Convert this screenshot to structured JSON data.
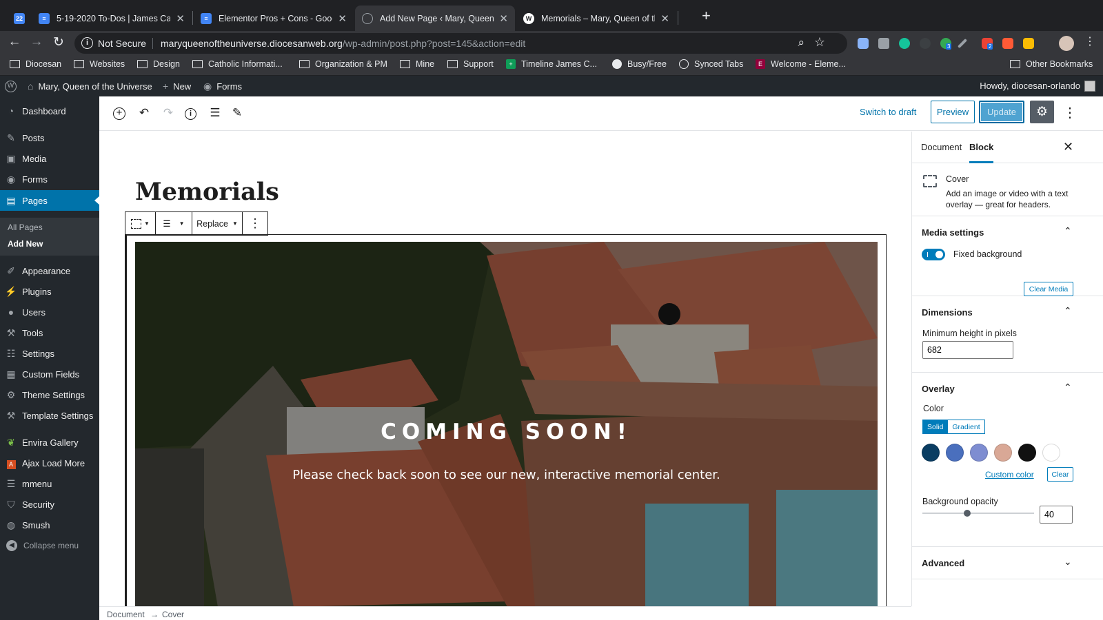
{
  "browser": {
    "tabs": [
      {
        "title": "22",
        "icon": "calendar-icon",
        "color": "#4285f4"
      },
      {
        "title": "5-19-2020 To-Dos | James Ca",
        "icon": "docs-icon",
        "color": "#4285f4"
      },
      {
        "title": "Elementor Pros + Cons - Goog",
        "icon": "docs-icon",
        "color": "#4285f4"
      },
      {
        "title": "Add New Page ‹ Mary, Queen c",
        "icon": "globe-icon",
        "color": "#5f6368"
      },
      {
        "title": "Memorials – Mary, Queen of th",
        "icon": "wordpress-icon",
        "color": "#ffffff"
      }
    ],
    "url": {
      "security": "Not Secure",
      "domain": "maryqueenoftheuniverse.diocesanweb.org",
      "path": "/wp-admin/post.php?post=145&action=edit"
    },
    "bookmarks": [
      "Diocesan",
      "Websites",
      "Design",
      "Catholic Informati...",
      "Organization & PM",
      "Mine",
      "Support",
      "Timeline James C...",
      "Busy/Free",
      "Synced Tabs",
      "Welcome - Eleme...",
      "Other Bookmarks"
    ],
    "extension_badges": [
      "3",
      "2"
    ]
  },
  "adminbar": {
    "site": "Mary, Queen of the Universe",
    "new": "New",
    "forms": "Forms",
    "howdy": "Howdy, diocesan-orlando"
  },
  "sidebar": {
    "items": [
      {
        "label": "Dashboard",
        "icon": "dashboard-icon"
      },
      {
        "label": "Posts",
        "icon": "pin-icon"
      },
      {
        "label": "Media",
        "icon": "media-icon"
      },
      {
        "label": "Forms",
        "icon": "forms-icon"
      },
      {
        "label": "Pages",
        "icon": "pages-icon"
      },
      {
        "label": "Appearance",
        "icon": "brush-icon"
      },
      {
        "label": "Plugins",
        "icon": "plugin-icon"
      },
      {
        "label": "Users",
        "icon": "user-icon"
      },
      {
        "label": "Tools",
        "icon": "wrench-icon"
      },
      {
        "label": "Settings",
        "icon": "settings-icon"
      },
      {
        "label": "Custom Fields",
        "icon": "table-icon"
      },
      {
        "label": "Theme Settings",
        "icon": "gear-icon"
      },
      {
        "label": "Template Settings",
        "icon": "wrench-icon"
      },
      {
        "label": "Envira Gallery",
        "icon": "leaf-icon"
      },
      {
        "label": "Ajax Load More",
        "icon": "ajax-icon"
      },
      {
        "label": "mmenu",
        "icon": "hamburger-icon"
      },
      {
        "label": "Security",
        "icon": "shield-icon"
      },
      {
        "label": "Smush",
        "icon": "smush-icon"
      }
    ],
    "submenu": [
      "All Pages",
      "Add New"
    ],
    "collapse": "Collapse menu"
  },
  "editor": {
    "switch_to_draft": "Switch to draft",
    "preview": "Preview",
    "update": "Update",
    "post_title": "Memorials",
    "toolbar": {
      "replace": "Replace"
    },
    "cover": {
      "title": "COMING SOON!",
      "subtitle": "Please check back soon to see our new, interactive memorial center.",
      "overlay_opacity": 0.4
    },
    "breadcrumb": [
      "Document",
      "Cover"
    ]
  },
  "settings": {
    "tabs": [
      "Document",
      "Block"
    ],
    "block_card": {
      "title": "Cover",
      "description": "Add an image or video with a text overlay — great for headers."
    },
    "media": {
      "heading": "Media settings",
      "fixed_background": "Fixed background",
      "fixed_background_on": true,
      "clear_media": "Clear Media"
    },
    "dimensions": {
      "heading": "Dimensions",
      "label": "Minimum height in pixels",
      "value": "682"
    },
    "overlay": {
      "heading": "Overlay",
      "color_label": "Color",
      "solid": "Solid",
      "gradient": "Gradient",
      "swatches": [
        "#0a3d62",
        "#4a6fbd",
        "#7e8dd1",
        "#d9a896",
        "#111111",
        "#ffffff"
      ],
      "custom_color": "Custom color",
      "clear": "Clear",
      "opacity_label": "Background opacity",
      "opacity_value": "40",
      "opacity_fraction": 0.4
    },
    "advanced": {
      "heading": "Advanced"
    }
  }
}
